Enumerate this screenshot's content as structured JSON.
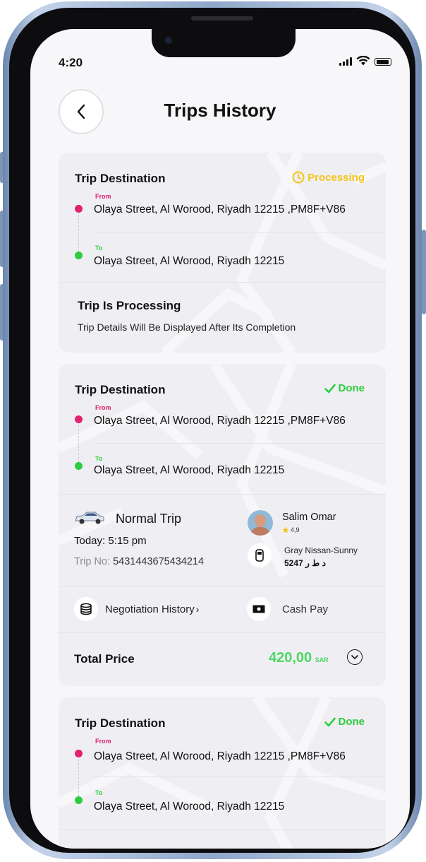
{
  "status_bar": {
    "time": "4:20"
  },
  "header": {
    "title": "Trips History"
  },
  "cards": [
    {
      "destination_title": "Trip Destination",
      "status": "Processing",
      "status_color": "#f5c518",
      "from_label": "From",
      "from_address": "Olaya Street, Al Worood, Riyadh 12215 ,PM8F+V86",
      "to_label": "To",
      "to_address": "Olaya Street, Al Worood, Riyadh 12215",
      "processing_title": "Trip Is Processing",
      "processing_message": "Trip Details Will Be Displayed After Its Completion"
    },
    {
      "destination_title": "Trip Destination",
      "status": "Done",
      "status_color": "#2ecc40",
      "from_label": "From",
      "from_address": "Olaya Street, Al Worood, Riyadh 12215 ,PM8F+V86",
      "to_label": "To",
      "to_address": "Olaya Street, Al Worood, Riyadh 12215",
      "trip_type": "Normal Trip",
      "trip_time": "Today: 5:15 pm",
      "trip_no_label": "Trip No:",
      "trip_no": "5431443675434214",
      "driver_name": "Salim Omar",
      "driver_rating": "4,9",
      "car_model": "Gray Nissan-Sunny",
      "plate": "5247 د ط ر",
      "negotiation_label": "Negotiation History",
      "payment_method": "Cash Pay",
      "total_label": "Total Price",
      "total_value": "420,00",
      "currency": "SAR"
    },
    {
      "destination_title": "Trip Destination",
      "status": "Done",
      "status_color": "#2ecc40",
      "from_label": "From",
      "from_address": "Olaya Street, Al Worood, Riyadh 12215 ,PM8F+V86",
      "to_label": "To",
      "to_address": "Olaya Street, Al Worood, Riyadh 12215"
    }
  ],
  "icons": [
    "back-arrow-icon",
    "clock-icon",
    "check-icon",
    "car-icon",
    "star-icon",
    "car-top-icon",
    "coins-icon",
    "cash-icon",
    "chevron-down-icon"
  ]
}
